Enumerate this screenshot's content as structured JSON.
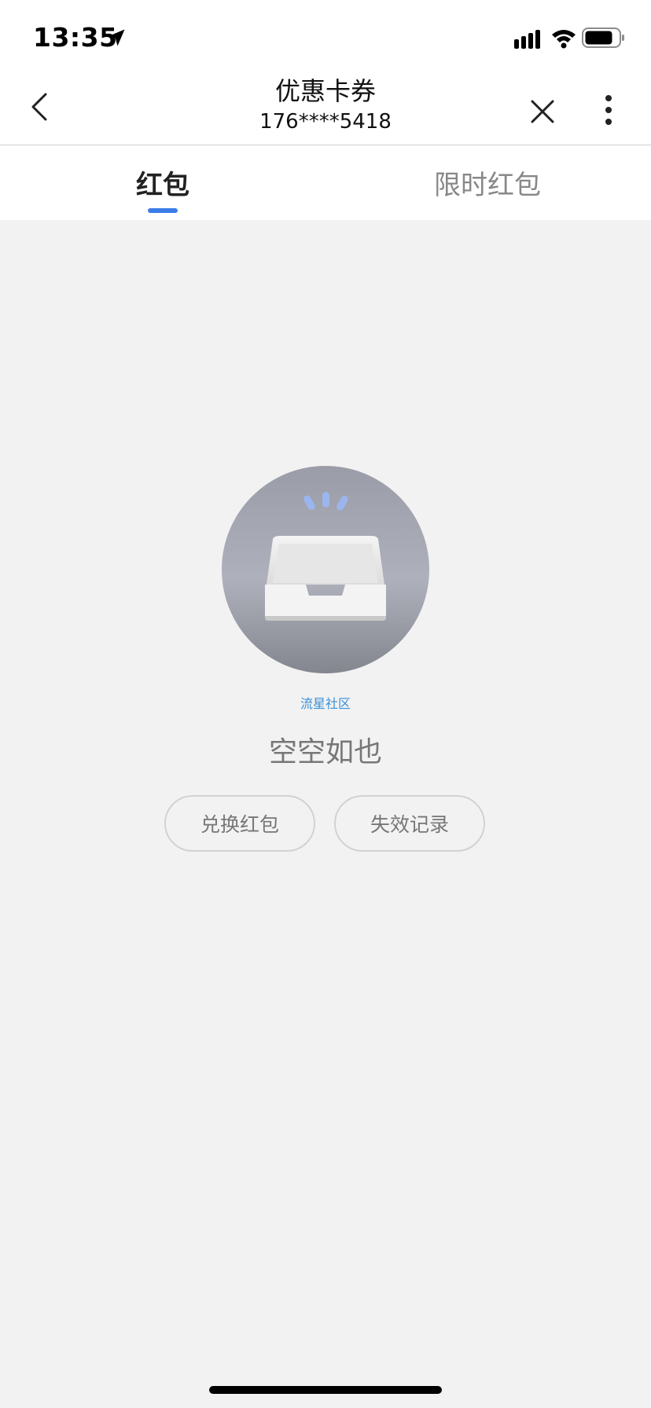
{
  "status_bar": {
    "time": "13:35",
    "icons": [
      "location-arrow-icon",
      "signal-icon",
      "wifi-icon",
      "battery-icon"
    ]
  },
  "nav": {
    "title": "优惠卡券",
    "subtitle": "176****5418",
    "icons": [
      "chevron-left-icon",
      "close-icon",
      "more-vertical-icon"
    ]
  },
  "tabs": [
    {
      "label": "红包",
      "active": true
    },
    {
      "label": "限时红包",
      "active": false
    }
  ],
  "empty_state": {
    "watermark": "流星社区",
    "message": "空空如也",
    "illustration": "empty-inbox-icon"
  },
  "actions": {
    "exchange_label": "兑换红包",
    "expired_label": "失效记录"
  },
  "colors": {
    "accent": "#3b7de8",
    "background": "#f2f2f2",
    "muted_text": "#777777"
  }
}
